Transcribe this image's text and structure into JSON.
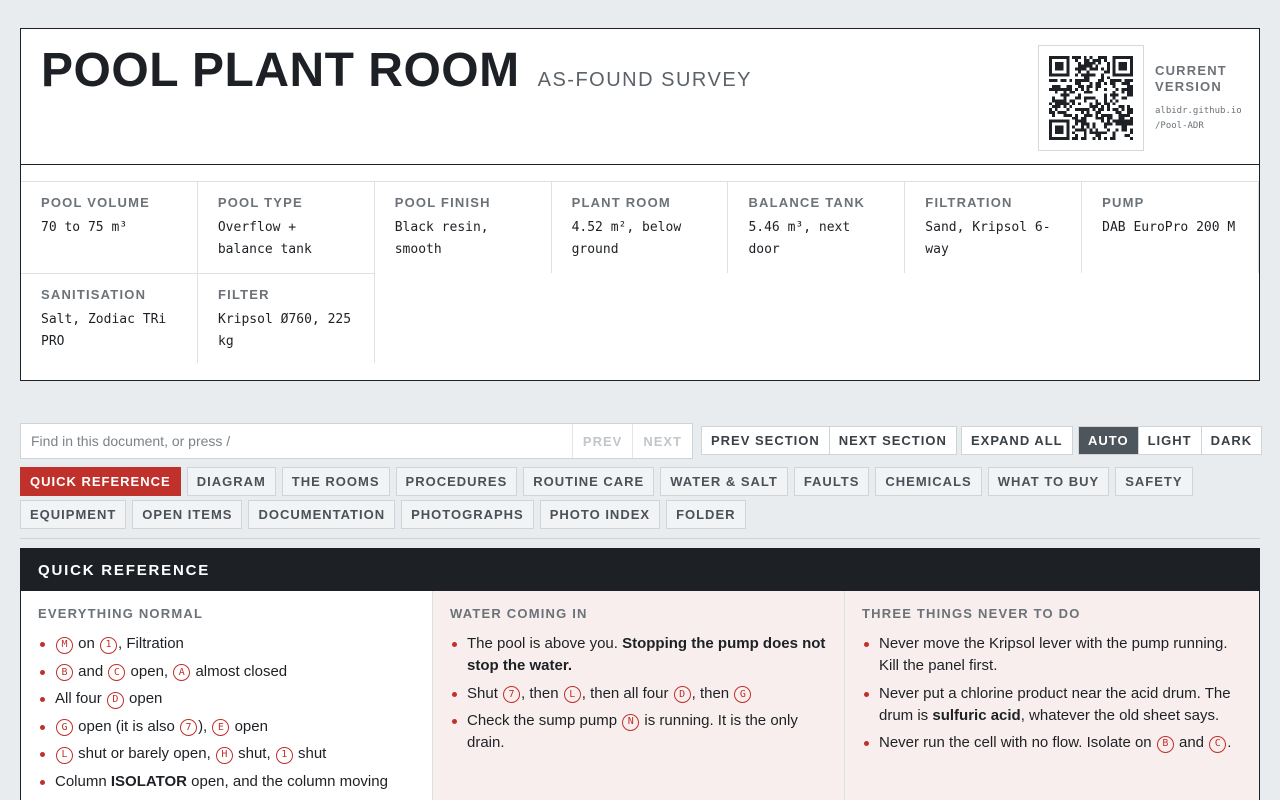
{
  "header": {
    "title": "POOL PLANT ROOM",
    "subtitle": "AS-FOUND SURVEY",
    "version_label": "CURRENT VERSION",
    "version_url_line1": "albidr.github.io",
    "version_url_line2": "/Pool-ADR"
  },
  "facts": [
    {
      "label": "POOL VOLUME",
      "value": "70 to 75 m³"
    },
    {
      "label": "POOL TYPE",
      "value": "Overflow + balance tank"
    },
    {
      "label": "POOL FINISH",
      "value": "Black resin, smooth"
    },
    {
      "label": "PLANT ROOM",
      "value": "4.52 m², below ground"
    },
    {
      "label": "BALANCE TANK",
      "value": "5.46 m³, next door"
    },
    {
      "label": "FILTRATION",
      "value": "Sand, Kripsol 6-way"
    },
    {
      "label": "PUMP",
      "value": "DAB EuroPro 200 M"
    },
    {
      "label": "SANITISATION",
      "value": "Salt, Zodiac TRi PRO"
    },
    {
      "label": "FILTER",
      "value": "Kripsol Ø760, 225 kg"
    }
  ],
  "toolbar": {
    "search_placeholder": "Find in this document, or press /",
    "prev": "PREV",
    "next": "NEXT",
    "prev_section": "PREV SECTION",
    "next_section": "NEXT SECTION",
    "expand_all": "EXPAND ALL",
    "theme_auto": "AUTO",
    "theme_light": "LIGHT",
    "theme_dark": "DARK",
    "active_theme": "AUTO"
  },
  "tabs_row1": [
    "QUICK REFERENCE",
    "DIAGRAM",
    "THE ROOMS",
    "PROCEDURES",
    "ROUTINE CARE",
    "WATER & SALT",
    "FAULTS",
    "CHEMICALS",
    "WHAT TO BUY",
    "SAFETY"
  ],
  "tabs_row2": [
    "EQUIPMENT",
    "OPEN ITEMS",
    "DOCUMENTATION",
    "PHOTOGRAPHS",
    "PHOTO INDEX",
    "FOLDER"
  ],
  "active_tab": "QUICK REFERENCE",
  "quick_reference": {
    "heading": "QUICK REFERENCE",
    "normal": {
      "title": "EVERYTHING NORMAL",
      "items": [
        {
          "tag1": "M",
          "t1": "on",
          "tag2": "1",
          "t2": ", Filtration"
        },
        {
          "tag1": "B",
          "t1": "and",
          "tag2": "C",
          "t2": "open,",
          "tag3": "A",
          "t3": "almost closed"
        },
        {
          "t0": "All four",
          "tag1": "D",
          "t1": "open"
        },
        {
          "tag1": "G",
          "t1": "open (it is also",
          "tag2": "7",
          "t2": "),",
          "tag3": "E",
          "t3": "open"
        },
        {
          "tag1": "L",
          "t1": "shut or barely open,",
          "tag2": "H",
          "t2": "shut,",
          "tag3": "1",
          "t3": "shut"
        },
        {
          "t0": "Column",
          "bold": "ISOLATOR",
          "t1": "open, and the column moving"
        }
      ]
    },
    "water": {
      "title": "WATER COMING IN",
      "item1_plain": "The pool is above you.",
      "item1_bold": "Stopping the pump does not stop the water.",
      "item2": {
        "t0": "Shut",
        "tag1": "7",
        "t1": ", then",
        "tag2": "L",
        "t2": ", then all four",
        "tag3": "D",
        "t3": ", then",
        "tag4": "G"
      },
      "item3": {
        "t0": "Check the sump pump",
        "tag1": "N",
        "t1": "is running. It is the only drain."
      }
    },
    "never": {
      "title": "THREE THINGS NEVER TO DO",
      "item1": "Never move the Kripsol lever with the pump running. Kill the panel first.",
      "item2_a": "Never put a chlorine product near the acid drum. The drum is",
      "item2_bold": "sulfuric acid",
      "item2_b": ", whatever the old sheet says.",
      "item3": {
        "t0": "Never run the cell with no flow. Isolate on",
        "tag1": "B",
        "t1": "and",
        "tag2": "C",
        "t2": "."
      }
    }
  }
}
